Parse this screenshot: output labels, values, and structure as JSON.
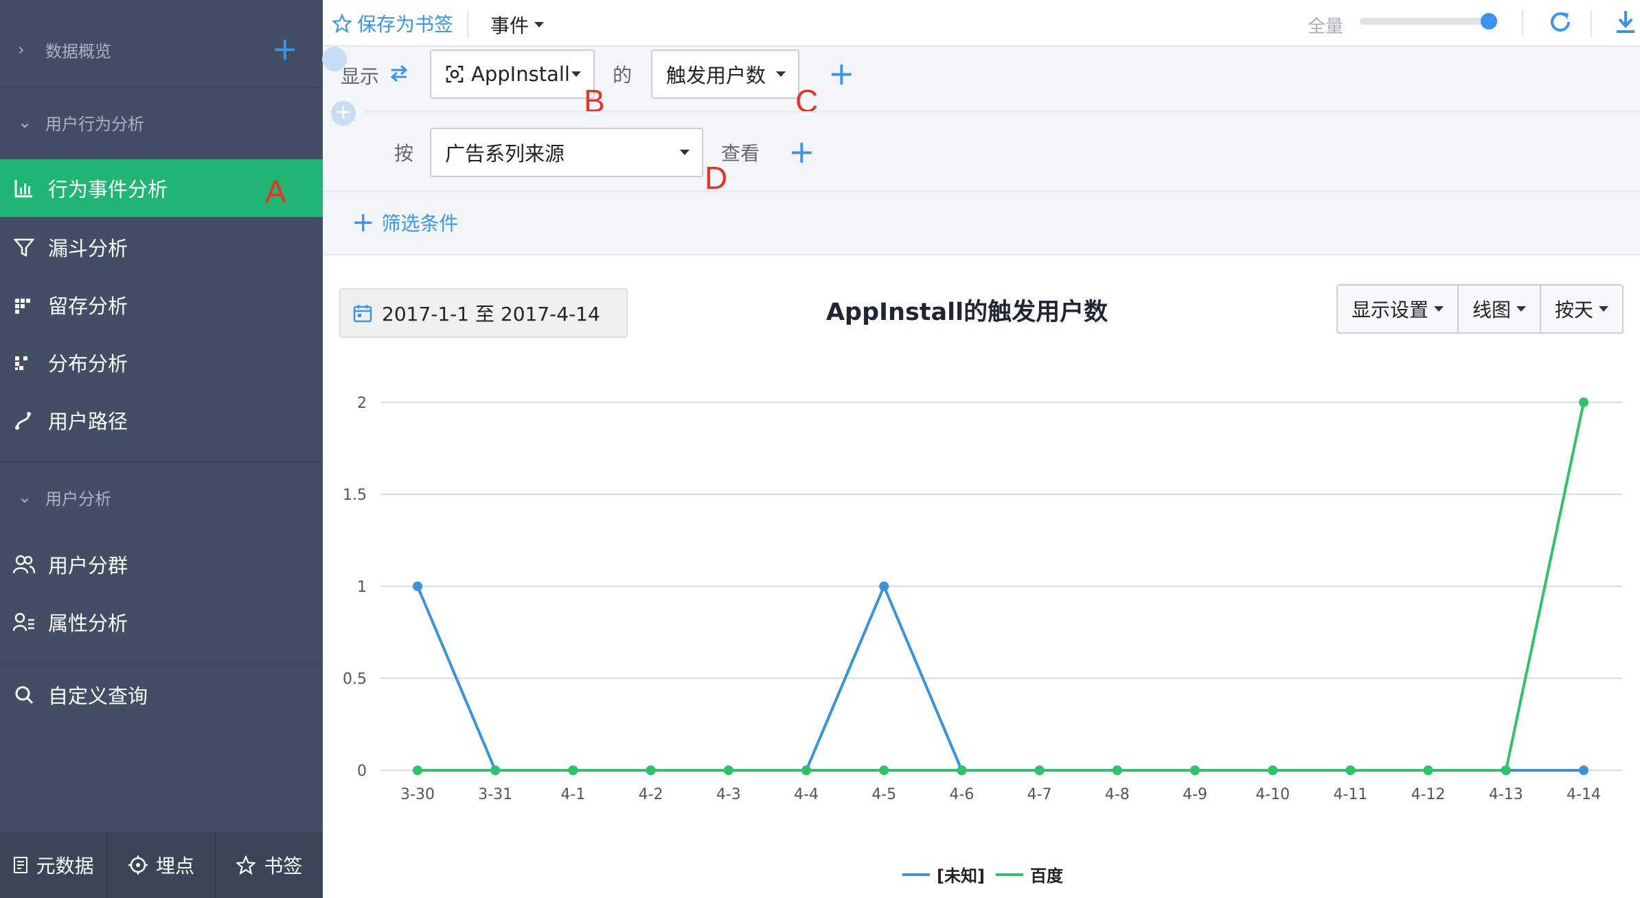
{
  "sidebar": {
    "section_overview": "数据概览",
    "section_behavior": "用户行为分析",
    "section_user": "用户分析",
    "items": {
      "event_analysis": "行为事件分析",
      "funnel": "漏斗分析",
      "retention": "留存分析",
      "distribution": "分布分析",
      "user_path": "用户路径",
      "user_group": "用户分群",
      "attr_analysis": "属性分析",
      "custom_query": "自定义查询"
    },
    "bottom": {
      "metadata": "元数据",
      "tracking": "埋点",
      "bookmark": "书签"
    },
    "accent": "#21b573"
  },
  "markers": {
    "a": "A",
    "b": "B",
    "c": "C",
    "d": "D"
  },
  "topbar": {
    "save_bookmark": "保存为书签",
    "event": "事件",
    "full": "全量",
    "sample_level": 1.0
  },
  "query": {
    "show_label": "显示",
    "event_select": "AppInstall",
    "of_label": "的",
    "metric_select": "触发用户数",
    "by_label": "按",
    "group_select": "广告系列来源",
    "view_label": "查看",
    "filter": "筛选条件"
  },
  "chart_controls": {
    "date_range": "2017-1-1 至 2017-4-14",
    "display_settings": "显示设置",
    "chart_type": "线图",
    "granularity": "按天"
  },
  "chart_data": {
    "type": "line",
    "title": "AppInstall的触发用户数",
    "x": [
      "3-30",
      "3-31",
      "4-1",
      "4-2",
      "4-3",
      "4-4",
      "4-5",
      "4-6",
      "4-7",
      "4-8",
      "4-9",
      "4-10",
      "4-11",
      "4-12",
      "4-13",
      "4-14"
    ],
    "ylim": [
      0,
      2
    ],
    "yticks": [
      "0",
      "0.5",
      "1",
      "1.5",
      "2"
    ],
    "grid": true,
    "legend_position": "bottom",
    "series": [
      {
        "name": "[未知]",
        "color": "#3a93d8",
        "values": [
          1,
          0,
          0,
          0,
          0,
          0,
          1,
          0,
          0,
          0,
          0,
          0,
          0,
          0,
          0,
          0
        ]
      },
      {
        "name": "百度",
        "color": "#2ec26b",
        "values": [
          0,
          0,
          0,
          0,
          0,
          0,
          0,
          0,
          0,
          0,
          0,
          0,
          0,
          0,
          0,
          2
        ]
      }
    ]
  }
}
